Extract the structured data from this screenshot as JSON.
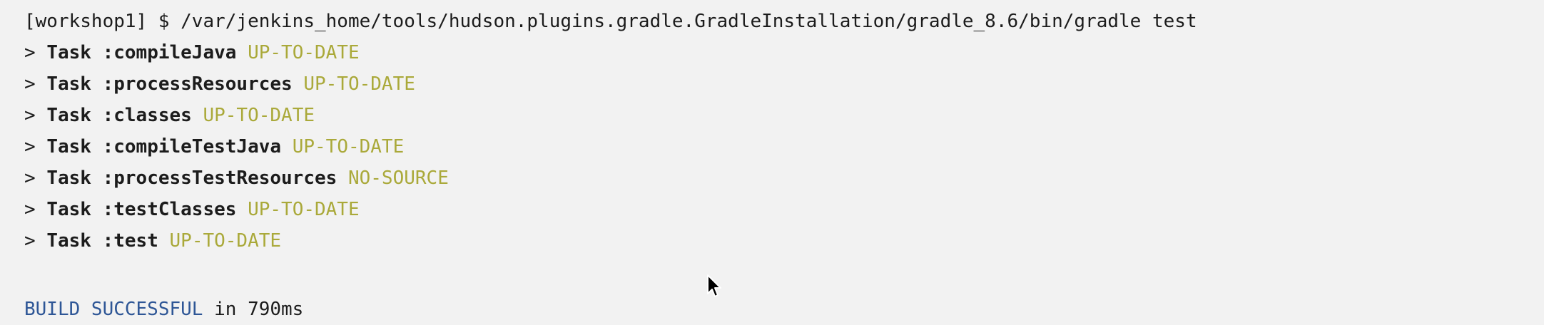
{
  "console": {
    "command": "[workshop1] $ /var/jenkins_home/tools/hudson.plugins.gradle.GradleInstallation/gradle_8.6/bin/gradle test",
    "tasks": [
      {
        "prefix": "> ",
        "name": "Task :compileJava",
        "status": "UP-TO-DATE"
      },
      {
        "prefix": "> ",
        "name": "Task :processResources",
        "status": "UP-TO-DATE"
      },
      {
        "prefix": "> ",
        "name": "Task :classes",
        "status": "UP-TO-DATE"
      },
      {
        "prefix": "> ",
        "name": "Task :compileTestJava",
        "status": "UP-TO-DATE"
      },
      {
        "prefix": "> ",
        "name": "Task :processTestResources",
        "status": "NO-SOURCE"
      },
      {
        "prefix": "> ",
        "name": "Task :testClasses",
        "status": "UP-TO-DATE"
      },
      {
        "prefix": "> ",
        "name": "Task :test",
        "status": "UP-TO-DATE"
      }
    ],
    "build_result": "BUILD SUCCESSFUL",
    "build_time": " in 790ms"
  },
  "colors": {
    "background": "#f2f2f2",
    "status": "#aaa93a",
    "build_status": "#2e5696"
  },
  "icons": {
    "cursor": "mouse-pointer-icon"
  }
}
